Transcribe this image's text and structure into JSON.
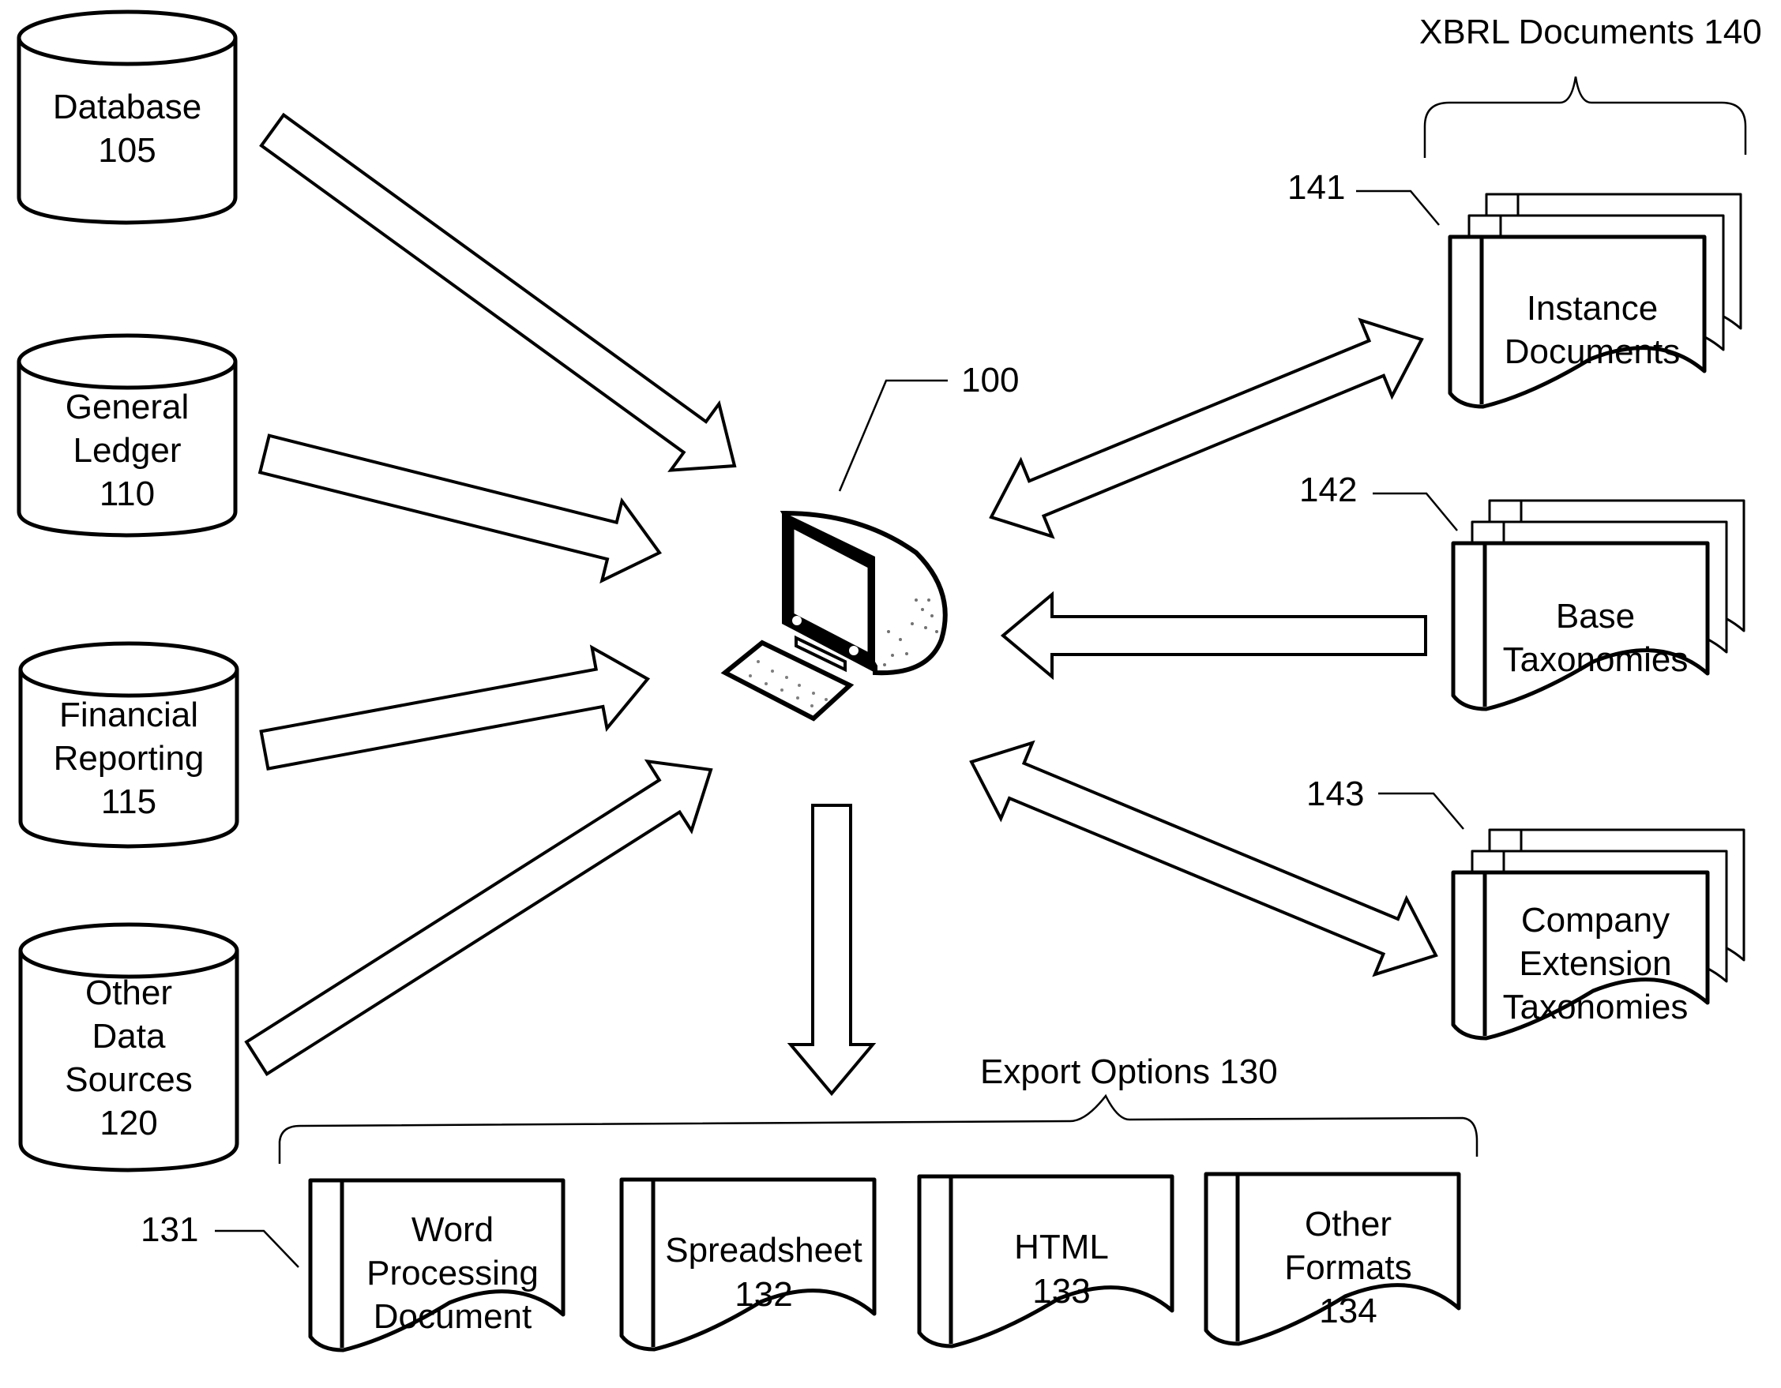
{
  "diagram": {
    "central_node": {
      "ref": "100",
      "icon": "desktop-computer-icon"
    },
    "data_sources": [
      {
        "lines": [
          "Database",
          "105"
        ]
      },
      {
        "lines": [
          "General",
          "Ledger",
          "110"
        ]
      },
      {
        "lines": [
          "Financial",
          "Reporting",
          "115"
        ]
      },
      {
        "lines": [
          "Other",
          "Data",
          "Sources",
          "120"
        ]
      }
    ],
    "xbrl_group": {
      "title": "XBRL Documents 140",
      "documents": [
        {
          "ref": "141",
          "lines": [
            "Instance",
            "Documents"
          ]
        },
        {
          "ref": "142",
          "lines": [
            "Base",
            "Taxonomies"
          ]
        },
        {
          "ref": "143",
          "lines": [
            "Company",
            "Extension",
            "Taxonomies"
          ]
        }
      ]
    },
    "export_group": {
      "title": "Export Options 130",
      "first_ref": "131",
      "documents": [
        {
          "lines": [
            "Word",
            "Processing",
            "Document"
          ]
        },
        {
          "lines": [
            "Spreadsheet",
            "132"
          ]
        },
        {
          "lines": [
            "HTML",
            "133"
          ]
        },
        {
          "lines": [
            "Other",
            "Formats",
            "134"
          ]
        }
      ]
    },
    "arrows": [
      {
        "from": "Database 105",
        "to": "100",
        "direction": "one-way"
      },
      {
        "from": "General Ledger 110",
        "to": "100",
        "direction": "one-way"
      },
      {
        "from": "Financial Reporting 115",
        "to": "100",
        "direction": "one-way"
      },
      {
        "from": "Other Data Sources 120",
        "to": "100",
        "direction": "one-way"
      },
      {
        "from": "100",
        "to": "Instance Documents",
        "direction": "two-way"
      },
      {
        "from": "Base Taxonomies",
        "to": "100",
        "direction": "one-way"
      },
      {
        "from": "100",
        "to": "Company Extension Taxonomies",
        "direction": "two-way"
      },
      {
        "from": "100",
        "to": "Export Options 130",
        "direction": "one-way"
      }
    ]
  }
}
